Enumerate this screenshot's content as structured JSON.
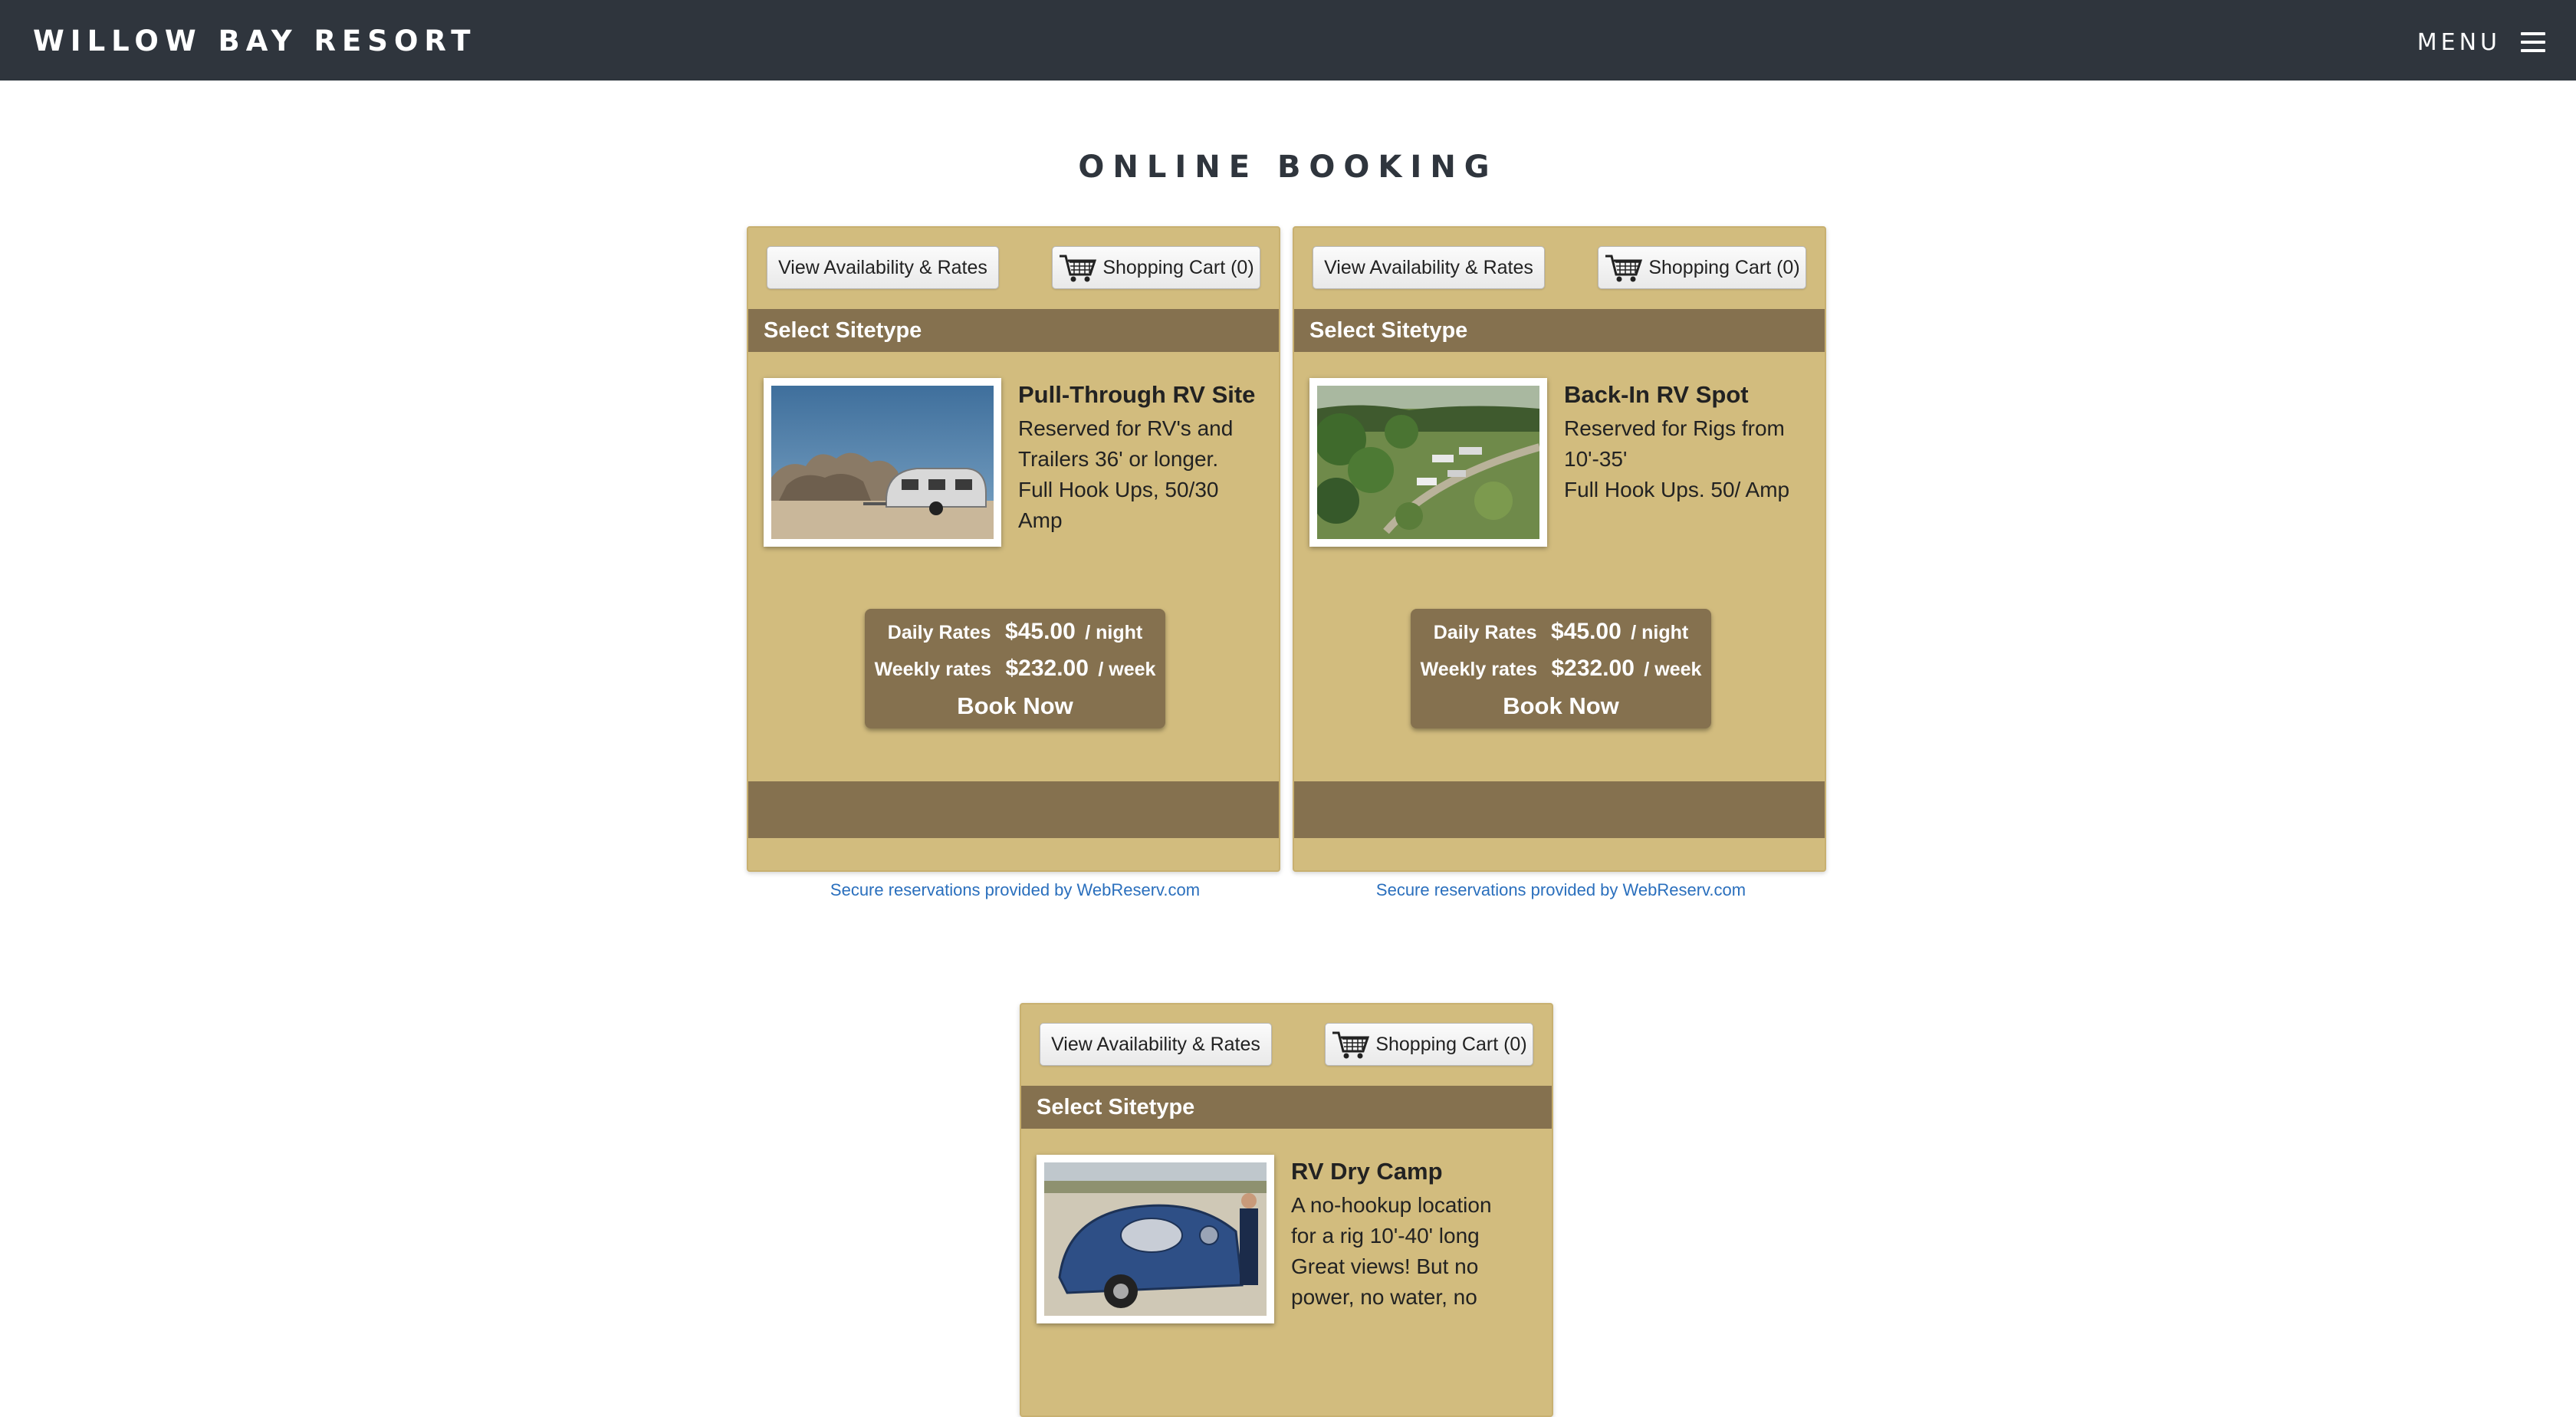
{
  "header": {
    "brand": "WILLOW BAY RESORT",
    "menu_label": "MENU"
  },
  "page_title": "ONLINE BOOKING",
  "colors": {
    "topbar": "#2f353d",
    "card": "#d2bc7e",
    "card_dark": "#85714f",
    "link": "#2a6fbd"
  },
  "cards": [
    {
      "avail_label": "View Availability & Rates",
      "cart_label": "Shopping Cart (0)",
      "section": "Select Sitetype",
      "site_name": "Pull-Through RV Site",
      "desc_lines": [
        "Reserved for RV's and",
        "Trailers 36' or longer.",
        "Full Hook Ups, 50/30",
        "Amp"
      ],
      "image": "airstream-trailer-desert-photo",
      "daily_label": "Daily Rates",
      "daily_amount": "$45.00",
      "daily_unit": "/ night",
      "weekly_label": "Weekly rates",
      "weekly_amount": "$232.00",
      "weekly_unit": "/ week",
      "book_label": "Book Now",
      "secure": "Secure reservations provided by WebReserv.com"
    },
    {
      "avail_label": "View Availability & Rates",
      "cart_label": "Shopping Cart (0)",
      "section": "Select Sitetype",
      "site_name": "Back-In RV Spot",
      "desc_lines": [
        "Reserved for Rigs from",
        "10'-35'",
        "Full Hook Ups. 50/ Amp"
      ],
      "image": "aerial-campground-photo",
      "daily_label": "Daily Rates",
      "daily_amount": "$45.00",
      "daily_unit": "/ night",
      "weekly_label": "Weekly rates",
      "weekly_amount": "$232.00",
      "weekly_unit": "/ week",
      "book_label": "Book Now",
      "secure": "Secure reservations provided by WebReserv.com"
    },
    {
      "avail_label": "View Availability & Rates",
      "cart_label": "Shopping Cart (0)",
      "section": "Select Sitetype",
      "site_name": "RV Dry Camp",
      "desc_lines": [
        "A no-hookup location",
        "for a rig 10'-40' long",
        "Great views! But no",
        "power, no water, no"
      ],
      "image": "teardrop-trailer-photo"
    }
  ]
}
